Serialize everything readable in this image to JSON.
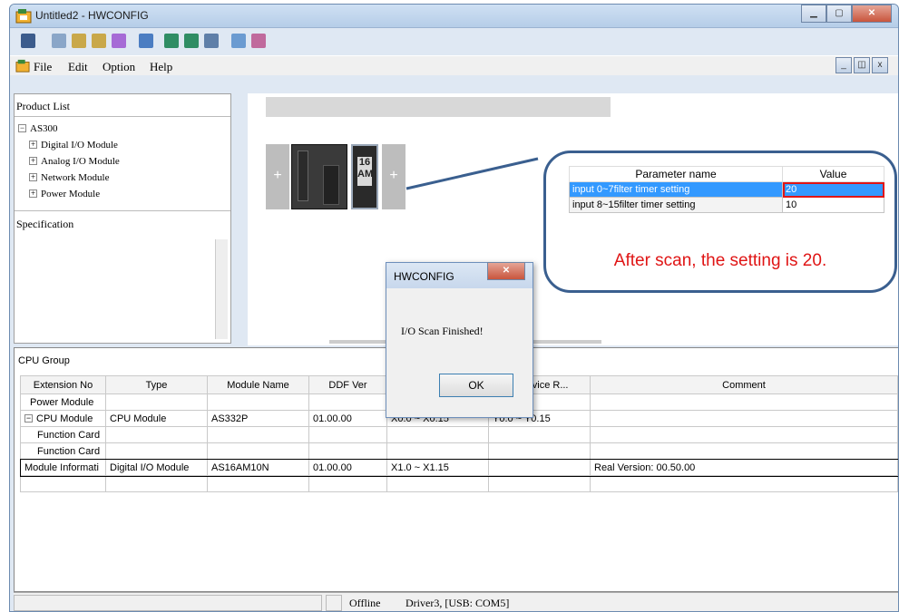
{
  "window": {
    "title": "Untitled2 - HWCONFIG"
  },
  "menu": {
    "file": "File",
    "edit": "Edit",
    "option": "Option",
    "help": "Help"
  },
  "left_panel": {
    "product_list_title": "Product List",
    "root": "AS300",
    "items": [
      "Digital I/O Module",
      "Analog I/O Module",
      "Network Module",
      "Power Module"
    ],
    "specification_title": "Specification"
  },
  "rack": {
    "module_label": "16\nAM"
  },
  "callout": {
    "headers": [
      "Parameter name",
      "Value"
    ],
    "rows": [
      {
        "name": "input 0~7filter timer setting",
        "value": "20"
      },
      {
        "name": "input 8~15filter timer setting",
        "value": "10"
      }
    ],
    "note": "After scan, the setting is 20."
  },
  "dialog": {
    "title": "HWCONFIG",
    "message": "I/O Scan Finished!",
    "ok_label": "OK"
  },
  "cpu_group": {
    "title": "CPU Group",
    "columns": [
      "Extension No",
      "Type",
      "Module Name",
      "DDF Ver",
      "",
      "Y Device R...",
      "Comment"
    ],
    "rows": [
      [
        "Power Module",
        "",
        "",
        "",
        "",
        "",
        ""
      ],
      [
        "CPU Module",
        "CPU Module",
        "AS332P",
        "01.00.00",
        "X0.0 ~ X0.15",
        "Y0.0 ~ Y0.15",
        ""
      ],
      [
        "Function Card",
        "",
        "",
        "",
        "",
        "",
        ""
      ],
      [
        "Function Card",
        "",
        "",
        "",
        "",
        "",
        ""
      ],
      [
        "Module Informati",
        "Digital I/O Module",
        "AS16AM10N",
        "01.00.00",
        "X1.0 ~ X1.15",
        "",
        "Real Version: 00.50.00"
      ]
    ]
  },
  "status": {
    "mode": "Offline",
    "driver": "Driver3, [USB: COM5]"
  },
  "colors": {
    "accent": "#3a5f8f",
    "highlight": "#3399ff",
    "note": "#e01515"
  }
}
